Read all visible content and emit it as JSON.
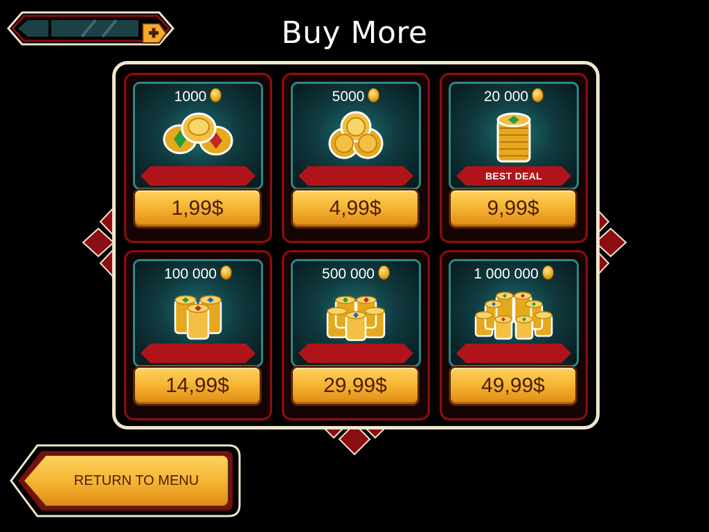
{
  "title": "Buy More",
  "hud": {
    "plus_icon": "plus-icon"
  },
  "packs": [
    {
      "amount": "1000",
      "price": "1,99$",
      "badge": "",
      "icon": "coin-pile-icon"
    },
    {
      "amount": "5000",
      "price": "4,99$",
      "badge": "",
      "icon": "coin-triple-icon"
    },
    {
      "amount": "20 000",
      "price": "9,99$",
      "badge": "BEST DEAL",
      "icon": "coin-stack-icon"
    },
    {
      "amount": "100 000",
      "price": "14,99$",
      "badge": "",
      "icon": "coin-stacks-icon"
    },
    {
      "amount": "500 000",
      "price": "29,99$",
      "badge": "",
      "icon": "coin-stacks-large-icon"
    },
    {
      "amount": "1 000 000",
      "price": "49,99$",
      "badge": "",
      "icon": "coin-hoard-icon"
    }
  ],
  "return_button": {
    "label": "RETURN TO MENU"
  },
  "colors": {
    "gold": "#f6b634",
    "crimson": "#8c0d12",
    "teal": "#2b8a8c",
    "cream": "#efe6cc"
  }
}
